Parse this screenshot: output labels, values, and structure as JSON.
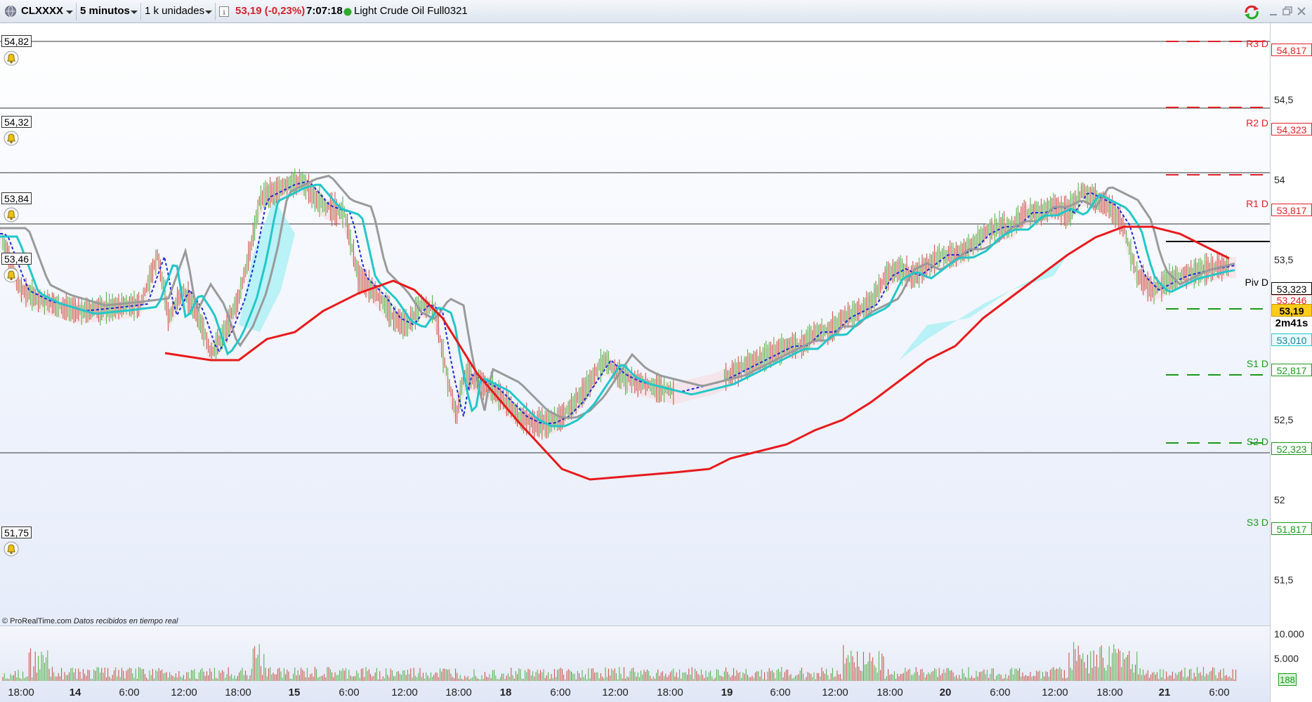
{
  "toolbar": {
    "symbol": "CLXXXX",
    "timeframe": "5 minutos",
    "units": "1 k unidades",
    "price_change": "53,19 (-0,23%)",
    "time": "7:07:18",
    "instrument": "Light Crude Oil Full0321"
  },
  "alerts": [
    {
      "label": "54,82"
    },
    {
      "label": "54,32"
    },
    {
      "label": "53,84"
    },
    {
      "label": "53,46"
    },
    {
      "label": "51,75"
    }
  ],
  "pivots": [
    {
      "name": "R3 D",
      "value": "54,817",
      "color": "#e21f26"
    },
    {
      "name": "R2 D",
      "value": "54,323",
      "color": "#e21f26"
    },
    {
      "name": "R1 D",
      "value": "53,817",
      "color": "#e21f26"
    },
    {
      "name": "Piv D",
      "value": "53,323",
      "color": "#000000"
    },
    {
      "name": "S1 D",
      "value": "52,817",
      "color": "#1a9a1a"
    },
    {
      "name": "S2 D",
      "value": "52,323",
      "color": "#1a9a1a"
    },
    {
      "name": "S3 D",
      "value": "51,817",
      "color": "#1a9a1a"
    }
  ],
  "price_tags": {
    "red_ma": "53,246",
    "last": "53,19",
    "countdown": "2m41s",
    "cyan_ma": "53,010",
    "volume_last": "188"
  },
  "y_axis": [
    "54,5",
    "54",
    "53,5",
    "53",
    "52,5",
    "52",
    "51,5"
  ],
  "vol_axis": [
    "10.000",
    "5.000"
  ],
  "x_axis": [
    {
      "label": "18:00",
      "bold": false
    },
    {
      "label": "14",
      "bold": true
    },
    {
      "label": "6:00",
      "bold": false
    },
    {
      "label": "12:00",
      "bold": false
    },
    {
      "label": "18:00",
      "bold": false
    },
    {
      "label": "15",
      "bold": true
    },
    {
      "label": "6:00",
      "bold": false
    },
    {
      "label": "12:00",
      "bold": false
    },
    {
      "label": "18:00",
      "bold": false
    },
    {
      "label": "18",
      "bold": true
    },
    {
      "label": "6:00",
      "bold": false
    },
    {
      "label": "12:00",
      "bold": false
    },
    {
      "label": "18:00",
      "bold": false
    },
    {
      "label": "19",
      "bold": true
    },
    {
      "label": "6:00",
      "bold": false
    },
    {
      "label": "12:00",
      "bold": false
    },
    {
      "label": "18:00",
      "bold": false
    },
    {
      "label": "20",
      "bold": true
    },
    {
      "label": "6:00",
      "bold": false
    },
    {
      "label": "12:00",
      "bold": false
    },
    {
      "label": "18:00",
      "bold": false
    },
    {
      "label": "21",
      "bold": true
    },
    {
      "label": "6:00",
      "bold": false
    }
  ],
  "credit": {
    "brand": "© ProRealTime.com",
    "note": "Datos recibidos en tiempo real"
  },
  "colors": {
    "red_ma": "#e8191c",
    "cyan_ma": "#22c7c9",
    "gray_ma": "#9a9a9a",
    "blue_dotted": "#1c2ad6",
    "cloud_cyan": "#9feff4",
    "cloud_pink": "#f8d8dc",
    "candle_up": "#4caf3c",
    "candle_down": "#c84a3c"
  }
}
